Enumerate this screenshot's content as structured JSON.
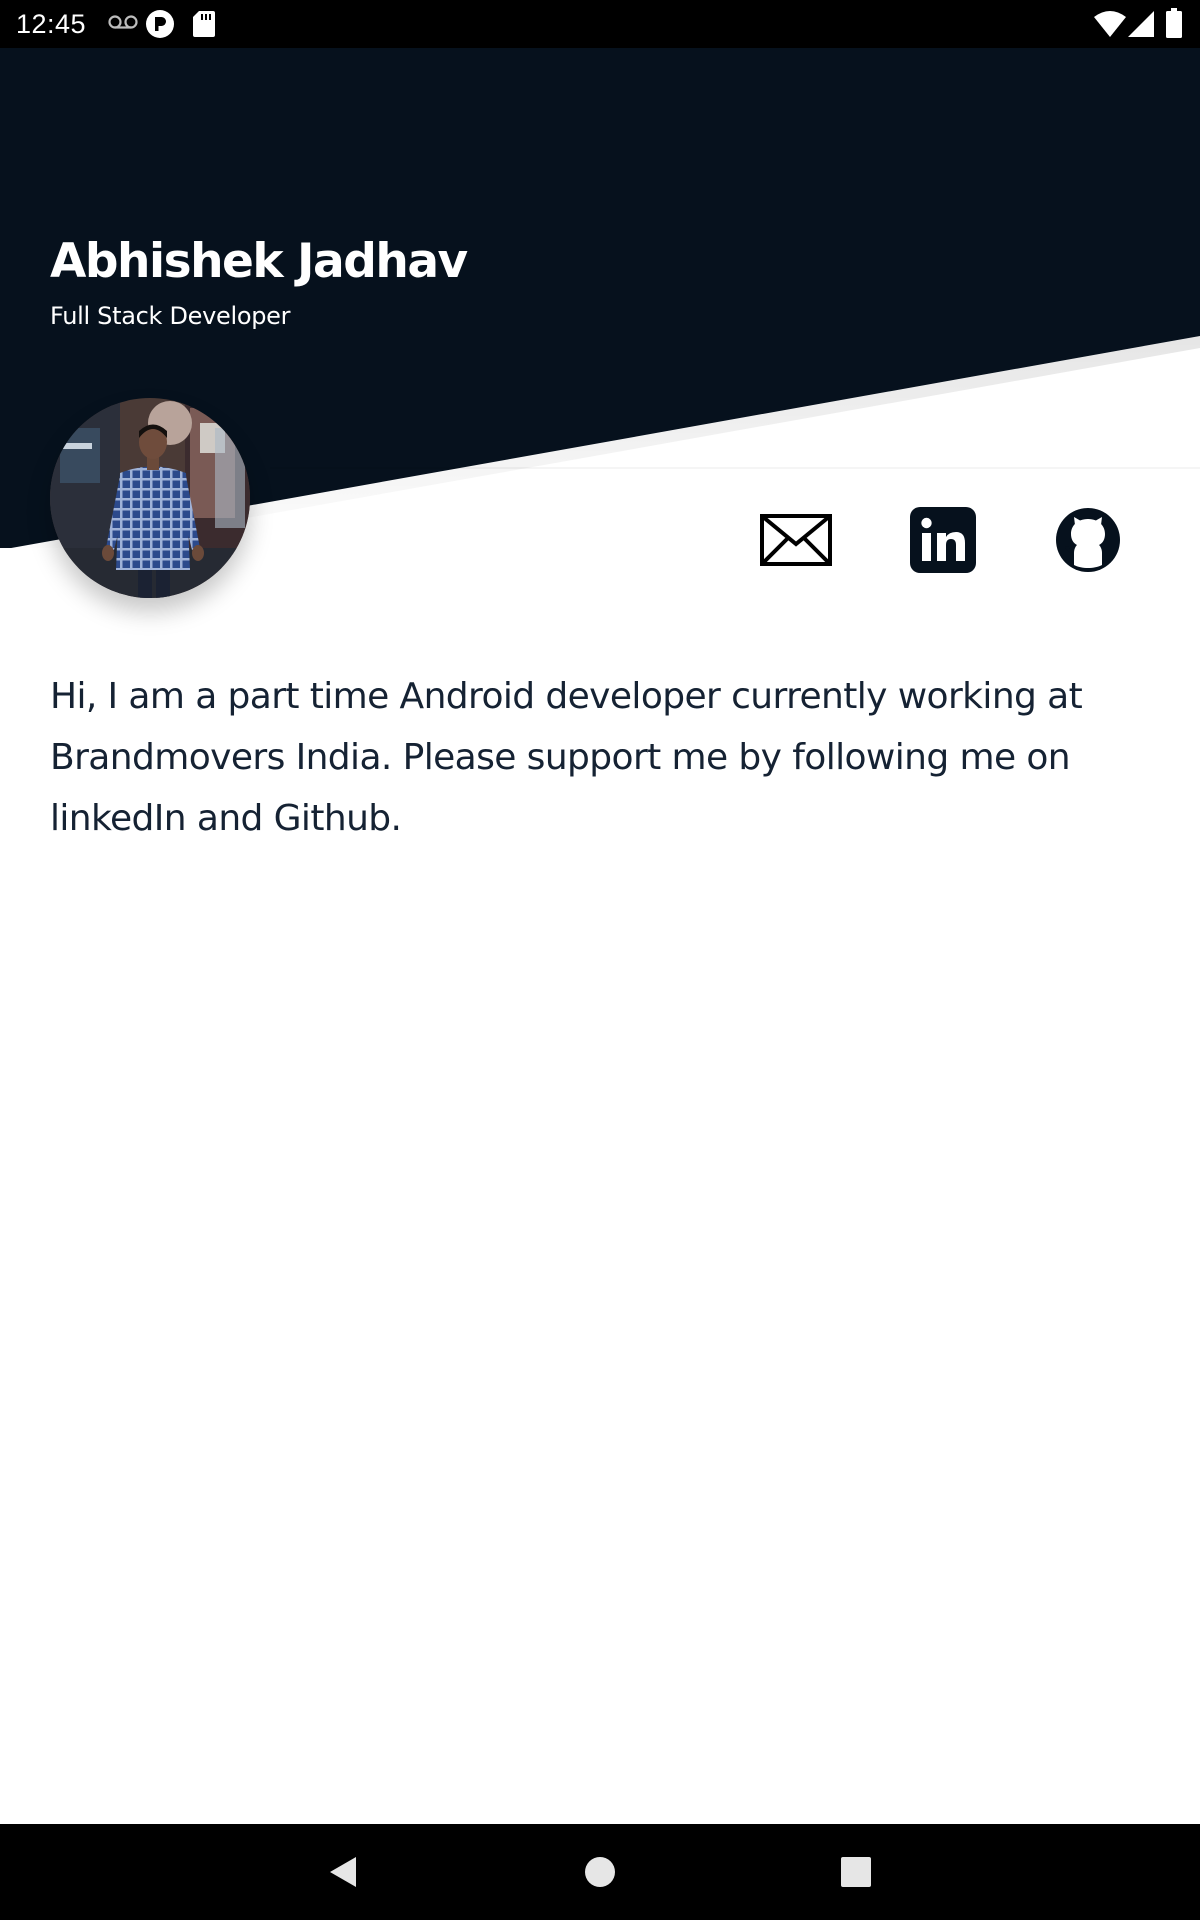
{
  "status_bar": {
    "time": "12:45",
    "icons": [
      "voicemail-icon",
      "app-notification-icon",
      "sd-card-icon",
      "wifi-icon",
      "cell-signal-icon",
      "battery-icon"
    ]
  },
  "profile": {
    "name": "Abhishek Jadhav",
    "role": "Full Stack Developer",
    "avatar": "profile-photo"
  },
  "social": [
    {
      "name": "email",
      "icon": "mail-icon"
    },
    {
      "name": "linkedin",
      "icon": "linkedin-icon"
    },
    {
      "name": "github",
      "icon": "github-icon"
    }
  ],
  "bio": "Hi, I am a part time Android developer currently working at Brandmovers India. Please support me by following me on linkedIn and Github.",
  "nav_bar": {
    "buttons": [
      "back-icon",
      "home-icon",
      "recents-icon"
    ]
  },
  "colors": {
    "header_bg": "#06111d",
    "text_dark": "#152233",
    "white": "#ffffff",
    "status_bar": "#000000"
  }
}
